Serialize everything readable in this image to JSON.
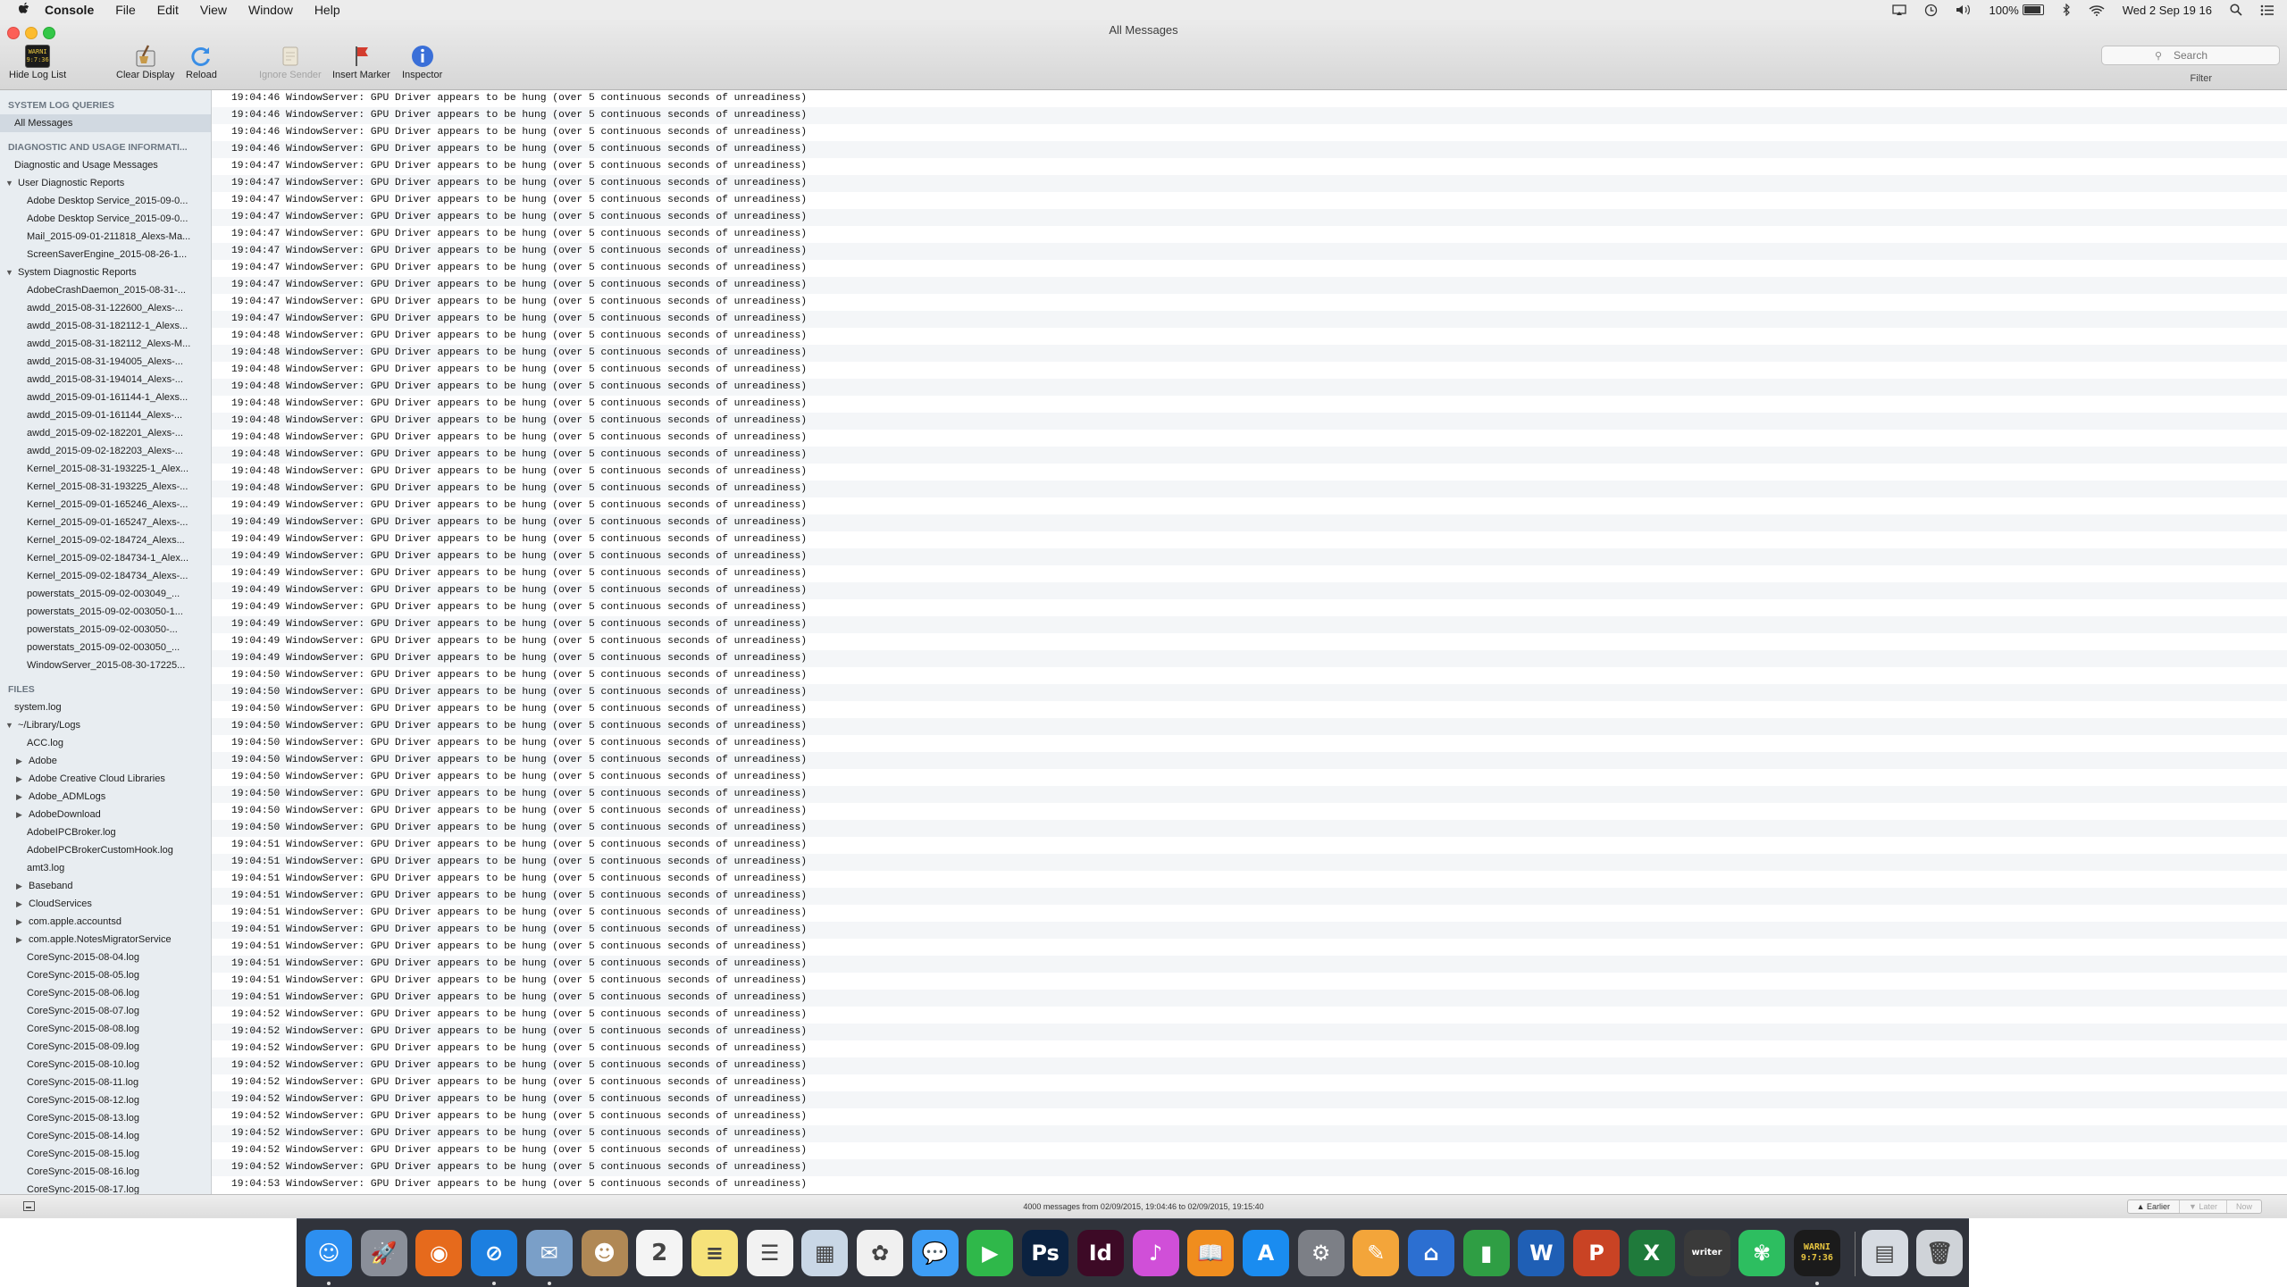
{
  "menubar": {
    "apple": "",
    "items": [
      "Console",
      "File",
      "Edit",
      "View",
      "Window",
      "Help"
    ],
    "battery": "100%",
    "clock": "Wed 2 Sep  19 16"
  },
  "window": {
    "title": "All Messages",
    "toolbar": {
      "hide_log_list": "Hide Log List",
      "clear_display": "Clear Display",
      "reload": "Reload",
      "ignore_sender": "Ignore Sender",
      "insert_marker": "Insert Marker",
      "inspector": "Inspector",
      "badge_text": "WARNI\n9:7:36"
    },
    "search": {
      "placeholder": "Search"
    },
    "filter_label": "Filter"
  },
  "sidebar": {
    "system_log_queries_header": "SYSTEM LOG QUERIES",
    "all_messages": "All Messages",
    "diagnostic_header": "DIAGNOSTIC AND USAGE INFORMATI...",
    "diagnostic_messages": "Diagnostic and Usage Messages",
    "user_reports_label": "User Diagnostic Reports",
    "user_reports": [
      "Adobe Desktop Service_2015-09-0...",
      "Adobe Desktop Service_2015-09-0...",
      "Mail_2015-09-01-211818_Alexs-Ma...",
      "ScreenSaverEngine_2015-08-26-1..."
    ],
    "system_reports_label": "System Diagnostic Reports",
    "system_reports": [
      "AdobeCrashDaemon_2015-08-31-...",
      "awdd_2015-08-31-122600_Alexs-...",
      "awdd_2015-08-31-182112-1_Alexs...",
      "awdd_2015-08-31-182112_Alexs-M...",
      "awdd_2015-08-31-194005_Alexs-...",
      "awdd_2015-08-31-194014_Alexs-...",
      "awdd_2015-09-01-161144-1_Alexs...",
      "awdd_2015-09-01-161144_Alexs-...",
      "awdd_2015-09-02-182201_Alexs-...",
      "awdd_2015-09-02-182203_Alexs-...",
      "Kernel_2015-08-31-193225-1_Alex...",
      "Kernel_2015-08-31-193225_Alexs-...",
      "Kernel_2015-09-01-165246_Alexs-...",
      "Kernel_2015-09-01-165247_Alexs-...",
      "Kernel_2015-09-02-184724_Alexs...",
      "Kernel_2015-09-02-184734-1_Alex...",
      "Kernel_2015-09-02-184734_Alexs-...",
      "powerstats_2015-09-02-003049_...",
      "powerstats_2015-09-02-003050-1...",
      "powerstats_2015-09-02-003050-...",
      "powerstats_2015-09-02-003050_...",
      "WindowServer_2015-08-30-17225..."
    ],
    "files_header": "FILES",
    "system_log": "system.log",
    "library_logs_label": "~/Library/Logs",
    "library_items": [
      {
        "label": "ACC.log",
        "folder": false
      },
      {
        "label": "Adobe",
        "folder": true
      },
      {
        "label": "Adobe Creative Cloud Libraries",
        "folder": true
      },
      {
        "label": "Adobe_ADMLogs",
        "folder": true
      },
      {
        "label": "AdobeDownload",
        "folder": true
      },
      {
        "label": "AdobeIPCBroker.log",
        "folder": false
      },
      {
        "label": "AdobeIPCBrokerCustomHook.log",
        "folder": false
      },
      {
        "label": "amt3.log",
        "folder": false
      },
      {
        "label": "Baseband",
        "folder": true
      },
      {
        "label": "CloudServices",
        "folder": true
      },
      {
        "label": "com.apple.accountsd",
        "folder": true
      },
      {
        "label": "com.apple.NotesMigratorService",
        "folder": true
      },
      {
        "label": "CoreSync-2015-08-04.log",
        "folder": false
      },
      {
        "label": "CoreSync-2015-08-05.log",
        "folder": false
      },
      {
        "label": "CoreSync-2015-08-06.log",
        "folder": false
      },
      {
        "label": "CoreSync-2015-08-07.log",
        "folder": false
      },
      {
        "label": "CoreSync-2015-08-08.log",
        "folder": false
      },
      {
        "label": "CoreSync-2015-08-09.log",
        "folder": false
      },
      {
        "label": "CoreSync-2015-08-10.log",
        "folder": false
      },
      {
        "label": "CoreSync-2015-08-11.log",
        "folder": false
      },
      {
        "label": "CoreSync-2015-08-12.log",
        "folder": false
      },
      {
        "label": "CoreSync-2015-08-13.log",
        "folder": false
      },
      {
        "label": "CoreSync-2015-08-14.log",
        "folder": false
      },
      {
        "label": "CoreSync-2015-08-15.log",
        "folder": false
      },
      {
        "label": "CoreSync-2015-08-16.log",
        "folder": false
      },
      {
        "label": "CoreSync-2015-08-17.log",
        "folder": false
      }
    ]
  },
  "log": {
    "message": "WindowServer: GPU Driver appears to be hung (over 5 continuous seconds of unreadiness)",
    "times": [
      "19:04:46",
      "19:04:46",
      "19:04:46",
      "19:04:46",
      "19:04:47",
      "19:04:47",
      "19:04:47",
      "19:04:47",
      "19:04:47",
      "19:04:47",
      "19:04:47",
      "19:04:47",
      "19:04:47",
      "19:04:47",
      "19:04:48",
      "19:04:48",
      "19:04:48",
      "19:04:48",
      "19:04:48",
      "19:04:48",
      "19:04:48",
      "19:04:48",
      "19:04:48",
      "19:04:48",
      "19:04:49",
      "19:04:49",
      "19:04:49",
      "19:04:49",
      "19:04:49",
      "19:04:49",
      "19:04:49",
      "19:04:49",
      "19:04:49",
      "19:04:49",
      "19:04:50",
      "19:04:50",
      "19:04:50",
      "19:04:50",
      "19:04:50",
      "19:04:50",
      "19:04:50",
      "19:04:50",
      "19:04:50",
      "19:04:50",
      "19:04:51",
      "19:04:51",
      "19:04:51",
      "19:04:51",
      "19:04:51",
      "19:04:51",
      "19:04:51",
      "19:04:51",
      "19:04:51",
      "19:04:51",
      "19:04:52",
      "19:04:52",
      "19:04:52",
      "19:04:52",
      "19:04:52",
      "19:04:52",
      "19:04:52",
      "19:04:52",
      "19:04:52",
      "19:04:52",
      "19:04:53"
    ]
  },
  "status": {
    "text": "4000 messages from 02/09/2015, 19:04:46 to 02/09/2015, 19:15:40",
    "earlier": "Earlier",
    "later": "Later",
    "now": "Now"
  },
  "dock": {
    "apps": [
      {
        "name": "finder",
        "glyph": "☺",
        "color": "#2d8ff0"
      },
      {
        "name": "launchpad",
        "glyph": "🚀",
        "color": "#8a8f99"
      },
      {
        "name": "firefox",
        "glyph": "◉",
        "color": "#e66a1c"
      },
      {
        "name": "safari",
        "glyph": "⊘",
        "color": "#1c7fe0"
      },
      {
        "name": "mail",
        "glyph": "✉",
        "color": "#7a9fc8"
      },
      {
        "name": "contacts",
        "glyph": "☻",
        "color": "#b08855"
      },
      {
        "name": "calendar",
        "glyph": "2",
        "color": "#f4f4f4"
      },
      {
        "name": "notes",
        "glyph": "≡",
        "color": "#f6e27a"
      },
      {
        "name": "reminders",
        "glyph": "☰",
        "color": "#f2f2f2"
      },
      {
        "name": "preview",
        "glyph": "▦",
        "color": "#c9d7e6"
      },
      {
        "name": "photos",
        "glyph": "✿",
        "color": "#f0f0f0"
      },
      {
        "name": "messages",
        "glyph": "💬",
        "color": "#3d9df5"
      },
      {
        "name": "facetime",
        "glyph": "▶",
        "color": "#2fb84a"
      },
      {
        "name": "photoshop",
        "glyph": "Ps",
        "color": "#0b2240"
      },
      {
        "name": "indesign",
        "glyph": "Id",
        "color": "#3d0a26"
      },
      {
        "name": "itunes",
        "glyph": "♪",
        "color": "#d04fd8"
      },
      {
        "name": "ibooks",
        "glyph": "📖",
        "color": "#f08d1e"
      },
      {
        "name": "app-store",
        "glyph": "A",
        "color": "#1a8cf0"
      },
      {
        "name": "system-preferences",
        "glyph": "⚙",
        "color": "#7c7f86"
      },
      {
        "name": "pages",
        "glyph": "✎",
        "color": "#f3a53a"
      },
      {
        "name": "keynote",
        "glyph": "⌂",
        "color": "#2c6fd1"
      },
      {
        "name": "numbers",
        "glyph": "▮",
        "color": "#2f9e44"
      },
      {
        "name": "word",
        "glyph": "W",
        "color": "#1f5fb5"
      },
      {
        "name": "powerpoint",
        "glyph": "P",
        "color": "#c94324"
      },
      {
        "name": "excel",
        "glyph": "X",
        "color": "#1f7a3b"
      },
      {
        "name": "writer",
        "glyph": "writer",
        "color": "#3a3a3a"
      },
      {
        "name": "evernote",
        "glyph": "✾",
        "color": "#2dbe60"
      },
      {
        "name": "console",
        "glyph": "WARNI\n9:7:36",
        "color": "#1b1b1b"
      },
      {
        "name": "documents-stack",
        "glyph": "▤",
        "color": "#d6dbe2"
      },
      {
        "name": "trash",
        "glyph": "🗑",
        "color": "#cfd3d8"
      }
    ]
  }
}
